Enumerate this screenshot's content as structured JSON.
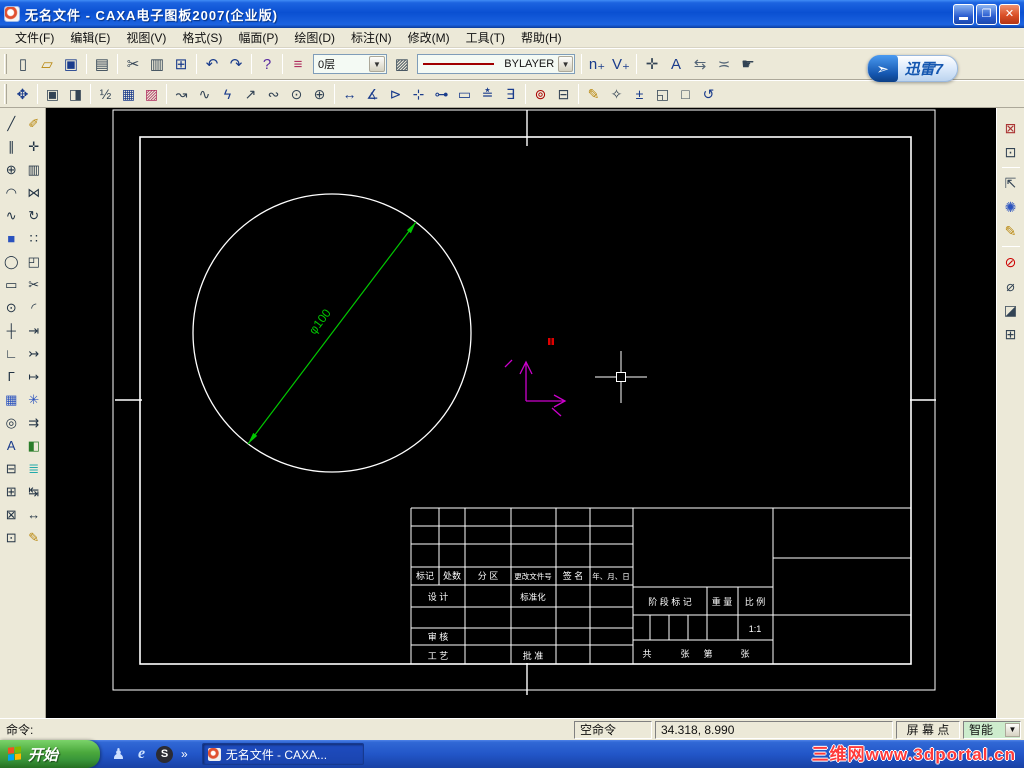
{
  "window": {
    "title": "无名文件 - CAXA电子图板2007(企业版)"
  },
  "colors": {
    "titlebar": "#0a50d2",
    "taskbar": "#2256c8",
    "start_button": "#39963a",
    "dimension": "#00c800",
    "axis": "#cc00cc",
    "point": "#e00000",
    "canvas_bg": "#000000",
    "frame": "#ffffff",
    "watermark_red": "#ff3a3a"
  },
  "menu": {
    "items": [
      "文件(F)",
      "编辑(E)",
      "视图(V)",
      "格式(S)",
      "幅面(P)",
      "绘图(D)",
      "标注(N)",
      "修改(M)",
      "工具(T)",
      "帮助(H)"
    ]
  },
  "toolbar_standard": {
    "layer_value": "0层",
    "linestyle_value": "BYLAYER",
    "items": [
      {
        "t": "g"
      },
      {
        "t": "b",
        "n": "new-file",
        "g": "▯",
        "c": "#345"
      },
      {
        "t": "b",
        "n": "open-file",
        "g": "▱",
        "c": "#b8860b"
      },
      {
        "t": "b",
        "n": "save-file",
        "g": "▣",
        "c": "#1a3c8c"
      },
      {
        "t": "s"
      },
      {
        "t": "b",
        "n": "print",
        "g": "▤",
        "c": "#345"
      },
      {
        "t": "s"
      },
      {
        "t": "b",
        "n": "cut",
        "g": "✂",
        "c": "#345"
      },
      {
        "t": "b",
        "n": "copy",
        "g": "▥",
        "c": "#345"
      },
      {
        "t": "b",
        "n": "paste",
        "g": "⊞",
        "c": "#1a3c8c"
      },
      {
        "t": "s"
      },
      {
        "t": "b",
        "n": "undo",
        "g": "↶",
        "c": "#1a3c8c"
      },
      {
        "t": "b",
        "n": "redo",
        "g": "↷",
        "c": "#1a3c8c"
      },
      {
        "t": "s"
      },
      {
        "t": "b",
        "n": "help",
        "g": "?",
        "c": "#5a2ca0"
      },
      {
        "t": "s"
      },
      {
        "t": "b",
        "n": "layer-manager",
        "g": "≡",
        "c": "#b03060"
      },
      {
        "t": "combo-layer"
      },
      {
        "t": "b",
        "n": "linestyle-manager",
        "g": "▨",
        "c": "#345"
      },
      {
        "t": "combo-linestyle"
      },
      {
        "t": "s"
      },
      {
        "t": "b",
        "n": "snap-nearest",
        "g": "n₊",
        "c": "#1a3c8c"
      },
      {
        "t": "b",
        "n": "snap-vertex",
        "g": "V₊",
        "c": "#1a3c8c"
      },
      {
        "t": "s"
      },
      {
        "t": "b",
        "n": "pick-filter",
        "g": "✛",
        "c": "#345"
      },
      {
        "t": "b",
        "n": "text-style",
        "g": "A",
        "c": "#1a3c8c"
      },
      {
        "t": "b",
        "n": "swap-pick",
        "g": "⇆",
        "c": "#567"
      },
      {
        "t": "b",
        "n": "match-props",
        "g": "≍",
        "c": "#567"
      },
      {
        "t": "b",
        "n": "page-pick",
        "g": "☛",
        "c": "#345"
      }
    ]
  },
  "toolbar_view": {
    "items": [
      {
        "t": "g"
      },
      {
        "t": "b",
        "n": "zoom-all",
        "g": "✥",
        "c": "#1a3c8c"
      },
      {
        "t": "s"
      },
      {
        "t": "b",
        "n": "frame-toggle",
        "g": "▣",
        "c": "#345"
      },
      {
        "t": "b",
        "n": "frame-text",
        "g": "◨",
        "c": "#345"
      },
      {
        "t": "s"
      },
      {
        "t": "b",
        "n": "dim-half",
        "g": "½",
        "c": "#345"
      },
      {
        "t": "b",
        "n": "table-text",
        "g": "▦",
        "c": "#1a3c8c"
      },
      {
        "t": "b",
        "n": "palette",
        "g": "▨",
        "c": "#b03060"
      },
      {
        "t": "s"
      },
      {
        "t": "b",
        "n": "point-tool",
        "g": "↝",
        "c": "#345"
      },
      {
        "t": "b",
        "n": "wave-tool",
        "g": "∿",
        "c": "#345"
      },
      {
        "t": "b",
        "n": "lightning-tool",
        "g": "ϟ",
        "c": "#1a3c8c"
      },
      {
        "t": "b",
        "n": "pointer-tool",
        "g": "↗",
        "c": "#345"
      },
      {
        "t": "b",
        "n": "lasso-tool",
        "g": "∾",
        "c": "#345"
      },
      {
        "t": "b",
        "n": "circle-pick",
        "g": "⊙",
        "c": "#345"
      },
      {
        "t": "b",
        "n": "center-pick",
        "g": "⊕",
        "c": "#345"
      },
      {
        "t": "s"
      },
      {
        "t": "b",
        "n": "dim-linear",
        "g": "↔",
        "c": "#1a3c8c"
      },
      {
        "t": "b",
        "n": "dim-angle",
        "g": "∡",
        "c": "#1a3c8c"
      },
      {
        "t": "b",
        "n": "dim-leader",
        "g": "⊳",
        "c": "#1a3c8c"
      },
      {
        "t": "b",
        "n": "dim-datum",
        "g": "⊹",
        "c": "#1a3c8c"
      },
      {
        "t": "b",
        "n": "dim-chain",
        "g": "⊶",
        "c": "#1a3c8c"
      },
      {
        "t": "b",
        "n": "dim-frame",
        "g": "▭",
        "c": "#1a3c8c"
      },
      {
        "t": "b",
        "n": "dim-special",
        "g": "≛",
        "c": "#1a3c8c"
      },
      {
        "t": "b",
        "n": "dim-edit",
        "g": "∃",
        "c": "#1a3c8c"
      },
      {
        "t": "s"
      },
      {
        "t": "b",
        "n": "query-zoom",
        "g": "⊚",
        "c": "#a00"
      },
      {
        "t": "b",
        "n": "query-measure",
        "g": "⊟",
        "c": "#345"
      },
      {
        "t": "s"
      },
      {
        "t": "b",
        "n": "edit-pencil",
        "g": "✎",
        "c": "#b8860b"
      },
      {
        "t": "b",
        "n": "edit-wand",
        "g": "✧",
        "c": "#345"
      },
      {
        "t": "b",
        "n": "zoom-dynamic",
        "g": "±",
        "c": "#1a3c8c"
      },
      {
        "t": "b",
        "n": "zoom-window",
        "g": "◱",
        "c": "#345"
      },
      {
        "t": "b",
        "n": "zoom-page",
        "g": "□",
        "c": "#345"
      },
      {
        "t": "b",
        "n": "view-previous",
        "g": "↺",
        "c": "#1a3c8c"
      }
    ]
  },
  "left_toolbar": {
    "col1": [
      {
        "n": "line",
        "g": "╱",
        "c": "#234"
      },
      {
        "n": "parallel-line",
        "g": "∥",
        "c": "#234"
      },
      {
        "n": "circle",
        "g": "⊕",
        "c": "#234"
      },
      {
        "n": "arc",
        "g": "◠",
        "c": "#234"
      },
      {
        "n": "spline",
        "g": "∿",
        "c": "#234"
      },
      {
        "n": "solid-fill",
        "g": "■",
        "c": "#2a52be"
      },
      {
        "n": "ellipse",
        "g": "◯",
        "c": "#234"
      },
      {
        "n": "rectangle",
        "g": "▭",
        "c": "#234"
      },
      {
        "n": "point",
        "g": "⊙",
        "c": "#234"
      },
      {
        "n": "center-line",
        "g": "┼",
        "c": "#234"
      },
      {
        "n": "contour-line",
        "g": "∟",
        "c": "#234"
      },
      {
        "n": "polyline",
        "g": "Γ",
        "c": "#234"
      },
      {
        "n": "hatch",
        "g": "▦",
        "c": "#2a52be"
      },
      {
        "n": "local-detail",
        "g": "◎",
        "c": "#234"
      },
      {
        "n": "text-tool",
        "g": "A",
        "c": "#1a3c8c"
      },
      {
        "n": "block-op",
        "g": "⊟",
        "c": "#234"
      },
      {
        "n": "dim-tool",
        "g": "⊞",
        "c": "#234"
      },
      {
        "n": "text-edit",
        "g": "⊠",
        "c": "#234"
      },
      {
        "n": "quick-dim",
        "g": "⊡",
        "c": "#234"
      }
    ],
    "col2": [
      {
        "n": "eraser",
        "g": "✐",
        "c": "#b8860b"
      },
      {
        "n": "move",
        "g": "✛",
        "c": "#234"
      },
      {
        "n": "copy-object",
        "g": "▥",
        "c": "#234"
      },
      {
        "n": "mirror",
        "g": "⋈",
        "c": "#234"
      },
      {
        "n": "rotate",
        "g": "↻",
        "c": "#234"
      },
      {
        "n": "array",
        "g": "∷",
        "c": "#234"
      },
      {
        "n": "stack",
        "g": "◰",
        "c": "#234"
      },
      {
        "n": "trim",
        "g": "✂",
        "c": "#234"
      },
      {
        "n": "fillet",
        "g": "◜",
        "c": "#234"
      },
      {
        "n": "extend",
        "g": "⇥",
        "c": "#234"
      },
      {
        "n": "break",
        "g": "↣",
        "c": "#234"
      },
      {
        "n": "stretch",
        "g": "↦",
        "c": "#234"
      },
      {
        "n": "explode",
        "g": "✳",
        "c": "#2a52be"
      },
      {
        "n": "shift",
        "g": "⇉",
        "c": "#234"
      },
      {
        "n": "block-insert",
        "g": "◧",
        "c": "#2a7d2a"
      },
      {
        "n": "layer-order",
        "g": "≣",
        "c": "#2aa"
      },
      {
        "n": "dim-adjust",
        "g": "↹",
        "c": "#234"
      },
      {
        "n": "dim-arrow",
        "g": "↔",
        "c": "#234"
      },
      {
        "n": "property-brush",
        "g": "✎",
        "c": "#b8860b"
      }
    ]
  },
  "right_toolbar": {
    "items": [
      {
        "n": "paper-ops",
        "g": "⊠",
        "c": "#a33"
      },
      {
        "n": "solid-3d",
        "g": "⊡",
        "c": "#345"
      },
      {
        "t": "s"
      },
      {
        "n": "paste-block",
        "g": "⇱",
        "c": "#345"
      },
      {
        "n": "render-sparkle",
        "g": "✺",
        "c": "#2a52be"
      },
      {
        "n": "edit-sheet",
        "g": "✎",
        "c": "#b8860b"
      },
      {
        "t": "s"
      },
      {
        "n": "view-red",
        "g": "⊘",
        "c": "#c00"
      },
      {
        "n": "view-hide",
        "g": "⌀",
        "c": "#345"
      },
      {
        "n": "section-fill",
        "g": "◪",
        "c": "#345"
      },
      {
        "n": "new-view",
        "g": "⊞",
        "c": "#345"
      }
    ]
  },
  "xunlei": {
    "label": "迅雷7"
  },
  "canvas": {
    "dimension_label": "φ100"
  },
  "title_block": {
    "mark": "标记",
    "count": "处数",
    "zone": "分 区",
    "change_no": "更改文件号",
    "sign": "签 名",
    "date": "年、月、日",
    "design": "设 计",
    "standardize": "标准化",
    "audit": "审 核",
    "process": "工 艺",
    "approve": "批 准",
    "stage": "阶 段 标 记",
    "weight": "重 量",
    "scale": "比 例",
    "scale_value": "1:1",
    "s_total": "共",
    "s_zhang1": "张",
    "s_di": "第",
    "s_zhang2": "张"
  },
  "status": {
    "prompt": "命令:",
    "command_state": "空命令",
    "coordinates": "34.318, 8.990",
    "point_mode": "屏 幕 点",
    "snap_mode": "智能"
  },
  "taskbar": {
    "start_label": "开始",
    "overflow": "»",
    "task_label": "无名文件 - CAXA...",
    "sogou_letter": "S",
    "ie_letter": "e",
    "msn_glyph": "♟"
  },
  "watermark": {
    "text": "三维网www.3dportal.cn"
  }
}
